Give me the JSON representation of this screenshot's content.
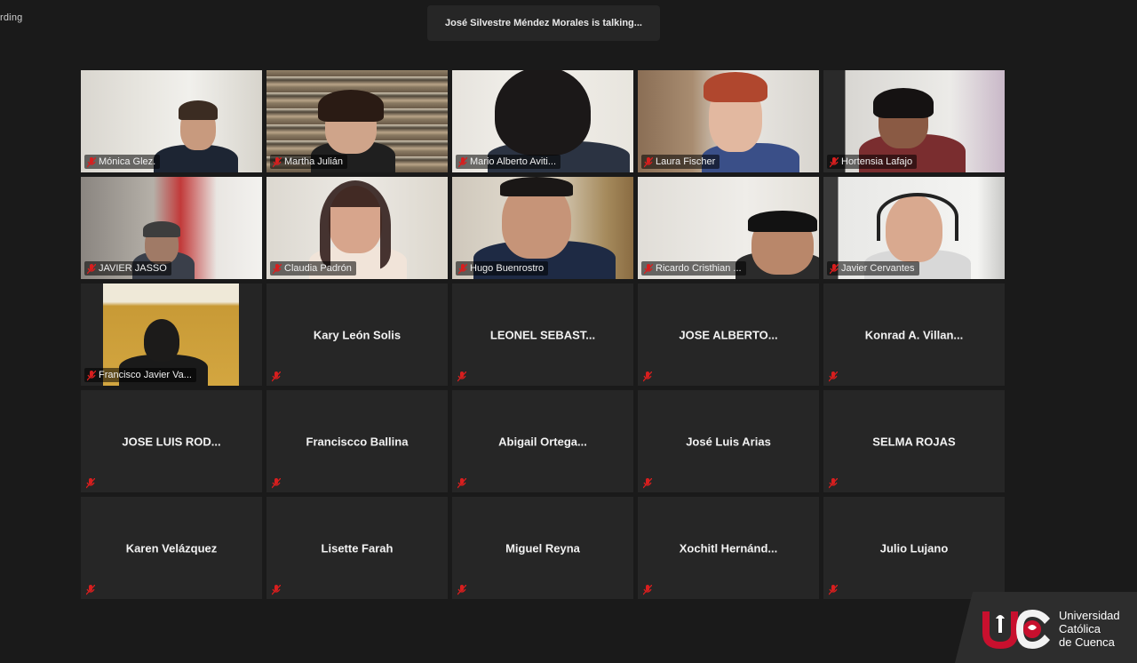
{
  "recording": {
    "label": "rding"
  },
  "banner": {
    "talking_text": "José Silvestre Méndez Morales is talking..."
  },
  "colors": {
    "mic_muted": "#d81e1e",
    "tile_bg": "#262626",
    "page_bg": "#1a1a1a",
    "brand_red": "#c8102e"
  },
  "participants": [
    {
      "name": "Mónica Glez.",
      "video": true
    },
    {
      "name": "Martha Julián",
      "video": true
    },
    {
      "name": "Mario Alberto Aviti...",
      "video": true
    },
    {
      "name": "Laura Fischer",
      "video": true
    },
    {
      "name": "Hortensia Lafajo",
      "video": true
    },
    {
      "name": "JAVIER JASSO",
      "video": true
    },
    {
      "name": "Claudia Padrón",
      "video": true
    },
    {
      "name": "Hugo Buenrostro",
      "video": true
    },
    {
      "name": "Ricardo Cristhian ...",
      "video": true
    },
    {
      "name": "Javier Cervantes",
      "video": true
    },
    {
      "name": "Francisco Javier Va...",
      "video": true
    },
    {
      "name": "Kary León Solis",
      "video": false
    },
    {
      "name": "LEONEL SEBAST...",
      "video": false
    },
    {
      "name": "JOSE ALBERTO...",
      "video": false
    },
    {
      "name": "Konrad A. Villan...",
      "video": false
    },
    {
      "name": "JOSE LUIS ROD...",
      "video": false
    },
    {
      "name": "Franciscco Ballina",
      "video": false
    },
    {
      "name": "Abigail Ortega...",
      "video": false
    },
    {
      "name": "José Luis Arias",
      "video": false
    },
    {
      "name": "SELMA ROJAS",
      "video": false
    },
    {
      "name": "Karen Velázquez",
      "video": false
    },
    {
      "name": "Lisette Farah",
      "video": false
    },
    {
      "name": "Miguel Reyna",
      "video": false
    },
    {
      "name": "Xochitl Hernánd...",
      "video": false
    },
    {
      "name": "Julio Lujano",
      "video": false
    }
  ],
  "logo": {
    "line1": "Universidad",
    "line2": "Católica",
    "line3": "de Cuenca"
  }
}
